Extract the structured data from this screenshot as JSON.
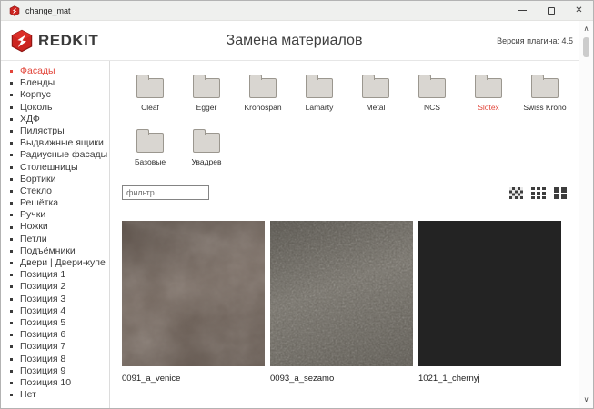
{
  "window": {
    "title": "change_mat",
    "controls": {
      "minimize_glyph": "–",
      "close_glyph": "✕"
    }
  },
  "header": {
    "brand": "REDKIT",
    "title": "Замена материалов",
    "version": "Версия плагина: 4.5"
  },
  "sidebar": {
    "items": [
      {
        "label": "Фасады",
        "active": true
      },
      {
        "label": "Бленды"
      },
      {
        "label": "Корпус"
      },
      {
        "label": "Цоколь"
      },
      {
        "label": "ХДФ"
      },
      {
        "label": "Пилястры"
      },
      {
        "label": "Выдвижные ящики"
      },
      {
        "label": "Радиусные фасады"
      },
      {
        "label": "Столешницы"
      },
      {
        "label": "Бортики"
      },
      {
        "label": "Стекло"
      },
      {
        "label": "Решётка"
      },
      {
        "label": "Ручки"
      },
      {
        "label": "Ножки"
      },
      {
        "label": "Петли"
      },
      {
        "label": "Подъёмники"
      },
      {
        "label": "Двери | Двери-купе"
      },
      {
        "label": "Позиция 1"
      },
      {
        "label": "Позиция 2"
      },
      {
        "label": "Позиция 3"
      },
      {
        "label": "Позиция 4"
      },
      {
        "label": "Позиция 5"
      },
      {
        "label": "Позиция 6"
      },
      {
        "label": "Позиция 7"
      },
      {
        "label": "Позиция 8"
      },
      {
        "label": "Позиция 9"
      },
      {
        "label": "Позиция 10"
      },
      {
        "label": "Нет"
      }
    ]
  },
  "folders": [
    {
      "label": "Cleaf"
    },
    {
      "label": "Egger"
    },
    {
      "label": "Kronospan"
    },
    {
      "label": "Lamarty"
    },
    {
      "label": "Metal"
    },
    {
      "label": "NCS"
    },
    {
      "label": "Slotex",
      "selected": true
    },
    {
      "label": "Swiss Krono"
    },
    {
      "label": "Базовые"
    },
    {
      "label": "Увадрев"
    }
  ],
  "toolbar": {
    "filter_placeholder": "фильтр",
    "view_modes": [
      "small-grid-icon",
      "medium-grid-icon",
      "large-grid-icon"
    ]
  },
  "materials": [
    {
      "name": "0091_a_venice",
      "base_color": "#6e6158"
    },
    {
      "name": "0093_a_sezamo",
      "base_color": "#6b675f"
    },
    {
      "name": "1021_1_chernyj",
      "base_color": "#232323"
    }
  ],
  "scrollbar": {
    "up_glyph": "∧",
    "down_glyph": "∨"
  },
  "colors": {
    "accent_red": "#e2453a",
    "folder_fill": "#d9d6d1",
    "text_dark": "#3b3b3b"
  }
}
